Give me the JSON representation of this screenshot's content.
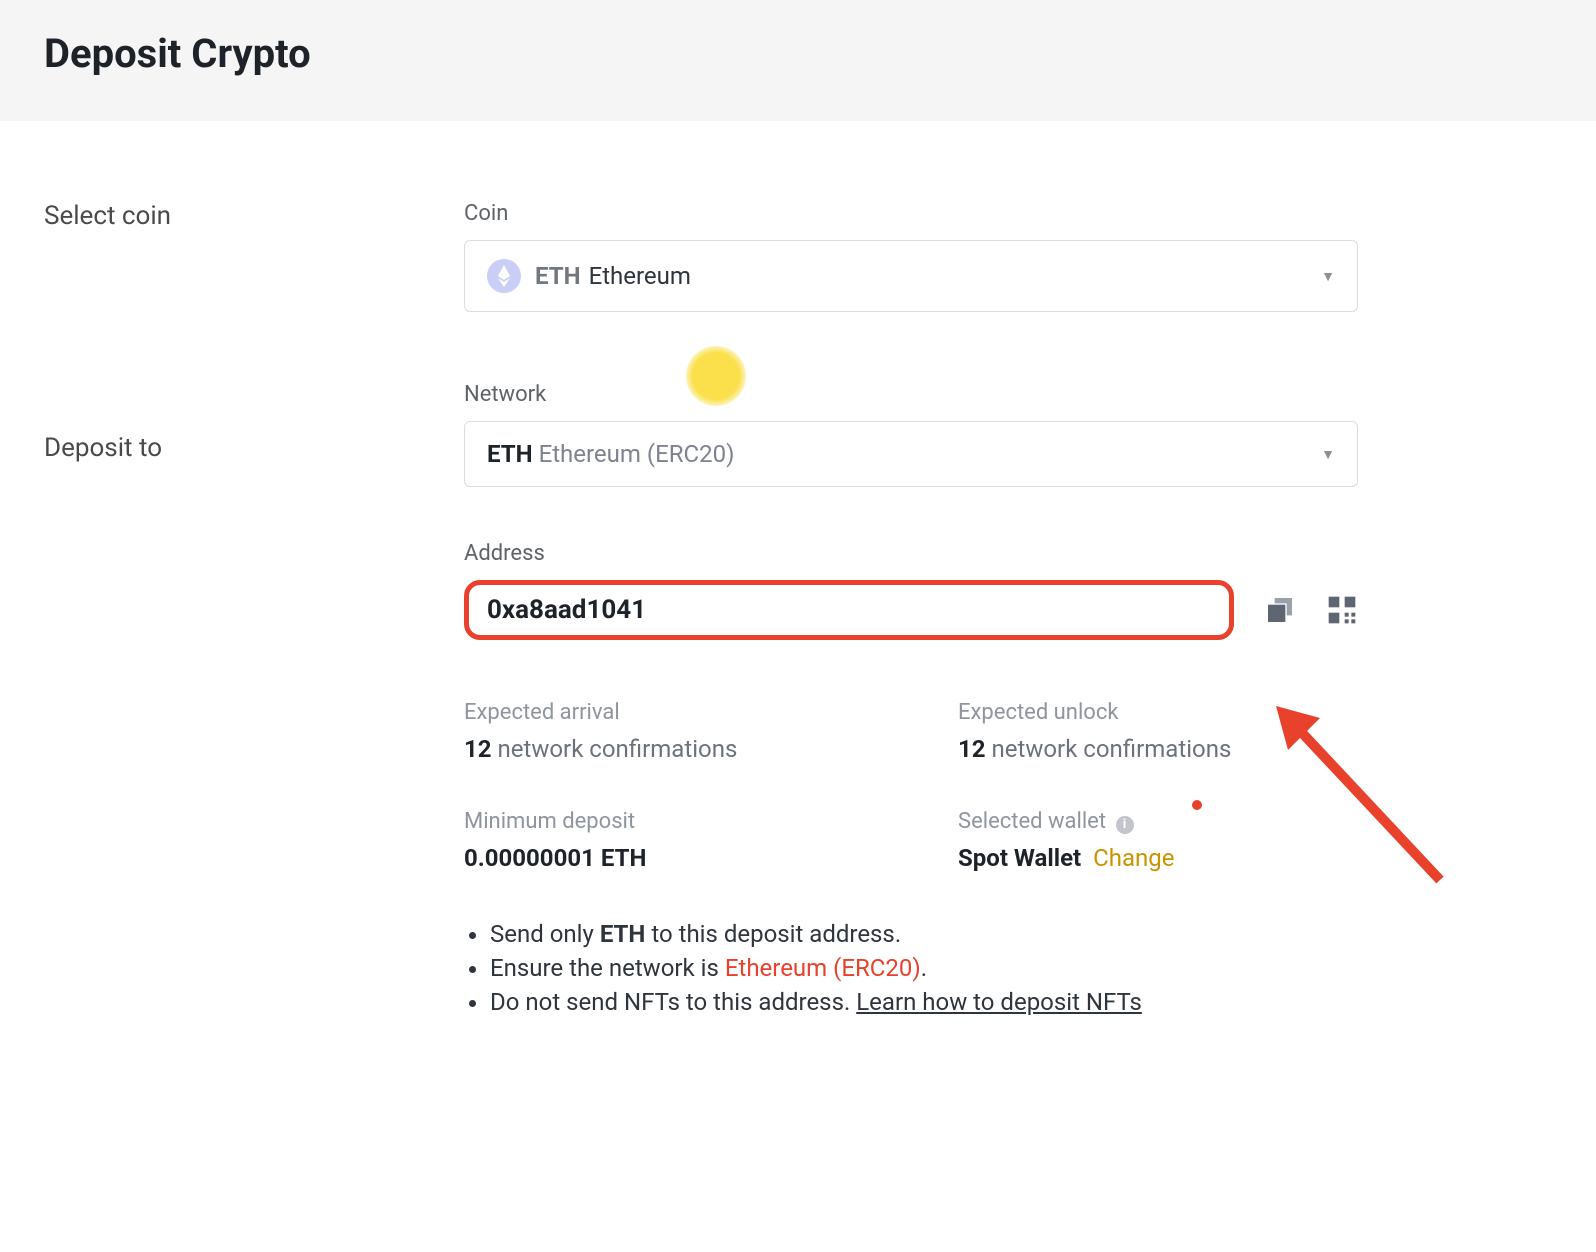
{
  "header": {
    "title": "Deposit Crypto"
  },
  "left": {
    "select_coin": "Select coin",
    "deposit_to": "Deposit to"
  },
  "coin": {
    "label": "Coin",
    "ticker": "ETH",
    "name": "Ethereum"
  },
  "network": {
    "label": "Network",
    "ticker": "ETH",
    "name": "Ethereum (ERC20)"
  },
  "address": {
    "label": "Address",
    "value": "0xa8aad1041"
  },
  "info": {
    "expected_arrival_label": "Expected arrival",
    "expected_arrival_num": "12",
    "expected_arrival_text": " network confirmations",
    "expected_unlock_label": "Expected unlock",
    "expected_unlock_num": "12",
    "expected_unlock_text": " network confirmations",
    "min_deposit_label": "Minimum deposit",
    "min_deposit_value": "0.00000001 ETH",
    "selected_wallet_label": "Selected wallet",
    "selected_wallet_value": "Spot Wallet",
    "change_label": "Change"
  },
  "notes": {
    "l1a": "Send only ",
    "l1b": "ETH",
    "l1c": " to this deposit address.",
    "l2a": "Ensure the network is ",
    "l2b": "Ethereum (ERC20)",
    "l2c": ".",
    "l3a": "Do not send NFTs to this address. ",
    "l3b": "Learn how to deposit NFTs"
  }
}
